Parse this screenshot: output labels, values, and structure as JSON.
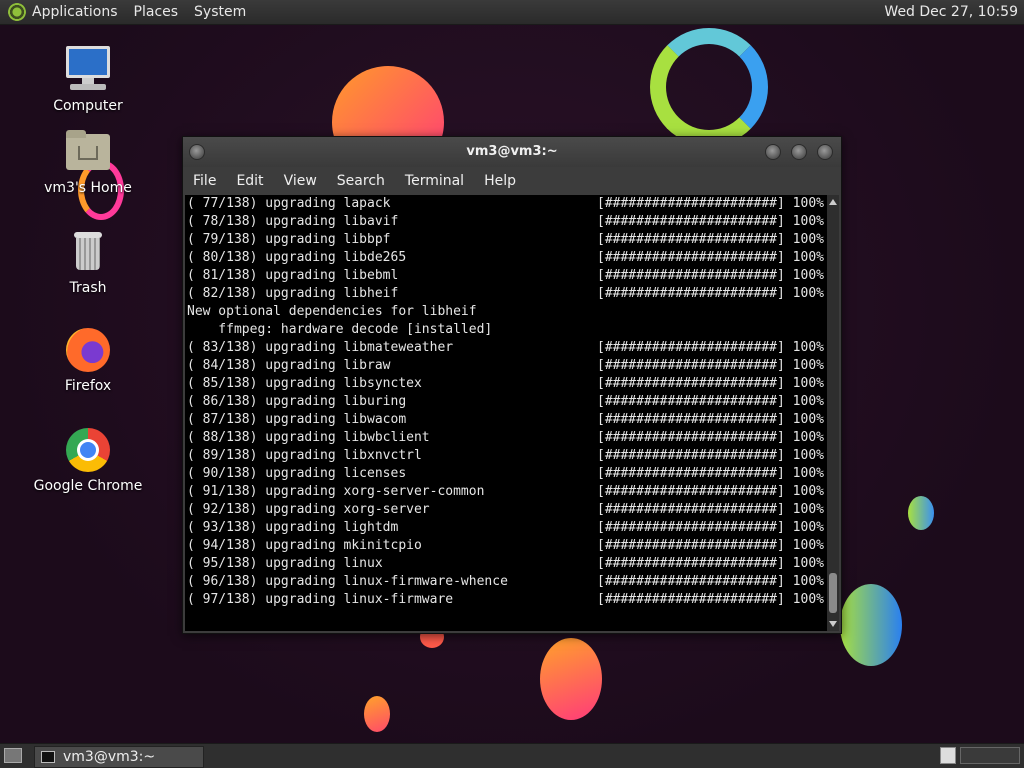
{
  "top_panel": {
    "menus": [
      "Applications",
      "Places",
      "System"
    ],
    "clock": "Wed Dec 27, 10:59"
  },
  "desktop_icons": [
    {
      "label": "Computer",
      "icon": "computer-icon"
    },
    {
      "label": "vm3's Home",
      "icon": "home-folder-icon"
    },
    {
      "label": "Trash",
      "icon": "trash-icon"
    },
    {
      "label": "Firefox",
      "icon": "firefox-icon"
    },
    {
      "label": "Google Chrome",
      "icon": "chrome-icon"
    }
  ],
  "terminal": {
    "title": "vm3@vm3:~",
    "menu": [
      "File",
      "Edit",
      "View",
      "Search",
      "Terminal",
      "Help"
    ],
    "lines": [
      {
        "text": "( 77/138) upgrading lapack",
        "progress": "[######################] 100%"
      },
      {
        "text": "( 78/138) upgrading libavif",
        "progress": "[######################] 100%"
      },
      {
        "text": "( 79/138) upgrading libbpf",
        "progress": "[######################] 100%"
      },
      {
        "text": "( 80/138) upgrading libde265",
        "progress": "[######################] 100%"
      },
      {
        "text": "( 81/138) upgrading libebml",
        "progress": "[######################] 100%"
      },
      {
        "text": "( 82/138) upgrading libheif",
        "progress": "[######################] 100%"
      },
      {
        "text": "New optional dependencies for libheif",
        "progress": ""
      },
      {
        "text": "    ffmpeg: hardware decode [installed]",
        "progress": ""
      },
      {
        "text": "( 83/138) upgrading libmateweather",
        "progress": "[######################] 100%"
      },
      {
        "text": "( 84/138) upgrading libraw",
        "progress": "[######################] 100%"
      },
      {
        "text": "( 85/138) upgrading libsynctex",
        "progress": "[######################] 100%"
      },
      {
        "text": "( 86/138) upgrading liburing",
        "progress": "[######################] 100%"
      },
      {
        "text": "( 87/138) upgrading libwacom",
        "progress": "[######################] 100%"
      },
      {
        "text": "( 88/138) upgrading libwbclient",
        "progress": "[######################] 100%"
      },
      {
        "text": "( 89/138) upgrading libxnvctrl",
        "progress": "[######################] 100%"
      },
      {
        "text": "( 90/138) upgrading licenses",
        "progress": "[######################] 100%"
      },
      {
        "text": "( 91/138) upgrading xorg-server-common",
        "progress": "[######################] 100%"
      },
      {
        "text": "( 92/138) upgrading xorg-server",
        "progress": "[######################] 100%"
      },
      {
        "text": "( 93/138) upgrading lightdm",
        "progress": "[######################] 100%"
      },
      {
        "text": "( 94/138) upgrading mkinitcpio",
        "progress": "[######################] 100%"
      },
      {
        "text": "( 95/138) upgrading linux",
        "progress": "[######################] 100%"
      },
      {
        "text": "( 96/138) upgrading linux-firmware-whence",
        "progress": "[######################] 100%"
      },
      {
        "text": "( 97/138) upgrading linux-firmware",
        "progress": "[######################] 100%"
      }
    ]
  },
  "bottom_panel": {
    "task_label": "vm3@vm3:~"
  }
}
